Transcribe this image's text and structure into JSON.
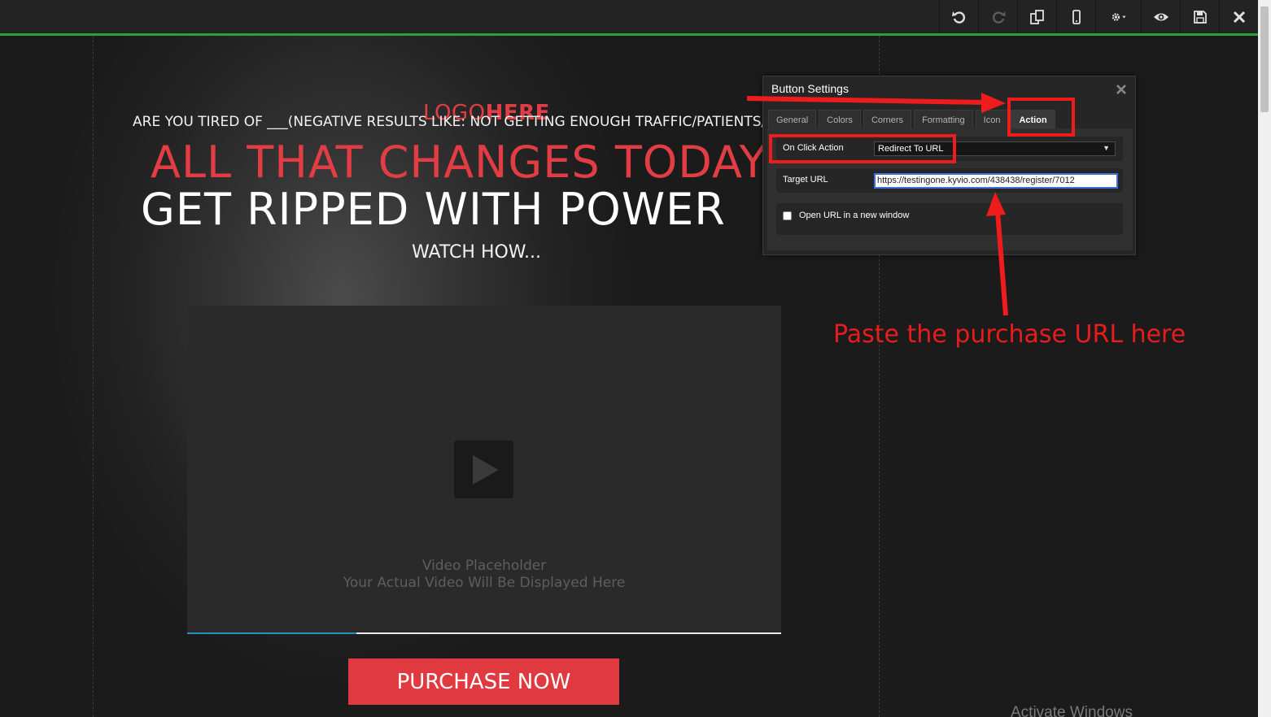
{
  "toolbar": {
    "buttons": [
      {
        "name": "undo-button",
        "icon": "undo-icon"
      },
      {
        "name": "redo-button",
        "icon": "redo-icon"
      },
      {
        "name": "duplicate-button",
        "icon": "copy-icon"
      },
      {
        "name": "mobile-view-button",
        "icon": "mobile-icon"
      },
      {
        "name": "settings-button",
        "icon": "gear-icon"
      },
      {
        "name": "preview-button",
        "icon": "eye-icon"
      },
      {
        "name": "save-button",
        "icon": "floppy-icon"
      },
      {
        "name": "close-button",
        "icon": "close-icon"
      }
    ],
    "accent_color": "#2f9f3a"
  },
  "page": {
    "logo_part1": "LOGO",
    "logo_part2": "HERE",
    "tagline": "ARE YOU TIRED OF ___(NEGATIVE RESULTS LIKE: NOT GETTING ENOUGH TRAFFIC/PATIENTS/VIE",
    "headline_red": "ALL THAT CHANGES TODAY",
    "headline_white": "GET RIPPED WITH POWER",
    "subhead": "WATCH HOW...",
    "video": {
      "placeholder_title": "Video Placeholder",
      "placeholder_subtitle": "Your Actual Video Will Be Displayed Here",
      "progress": 0.285
    },
    "purchase_button": "PURCHASE NOW",
    "accent_color": "#e23d45"
  },
  "dialog": {
    "title": "Button Settings",
    "tabs": [
      "General",
      "Colors",
      "Corners",
      "Formatting",
      "Icon",
      "Action"
    ],
    "active_tab": "Action",
    "on_click_label": "On Click Action",
    "on_click_value": "Redirect To URL",
    "target_url_label": "Target URL",
    "target_url_value": "https://testingone.kyvio.com/438438/register/7012",
    "new_window_label": "Open URL in a new window",
    "new_window_checked": false
  },
  "annotation": {
    "text": "Paste the purchase URL here",
    "color": "#ee1c1c"
  },
  "watermark": "Activate Windows"
}
